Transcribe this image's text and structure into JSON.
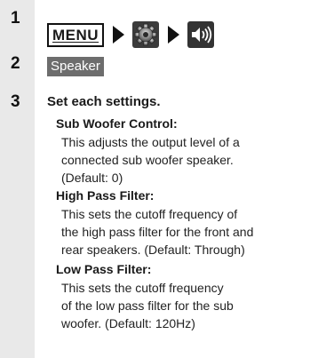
{
  "steps": [
    {
      "number": "1"
    },
    {
      "number": "2"
    },
    {
      "number": "3"
    }
  ],
  "step1": {
    "menu_key": "MENU",
    "icons": [
      "settings-gear-icon",
      "speaker-volume-icon"
    ]
  },
  "step2": {
    "button_label": "Speaker"
  },
  "step3": {
    "title": "Set each settings.",
    "items": [
      {
        "term": "Sub Woofer Control:",
        "description": "This adjusts the output level of a\nconnected sub woofer speaker.\n(Default: 0)"
      },
      {
        "term": "High Pass Filter:",
        "description": "This sets the cutoff frequency of\nthe high pass filter for the front and\nrear speakers. (Default: Through)"
      },
      {
        "term": "Low Pass Filter:",
        "description": "This sets the cutoff frequency\nof the low pass filter for the sub\nwoofer. (Default: 120Hz)"
      }
    ]
  },
  "colors": {
    "sidebar": "#e9e9e9",
    "button": "#6d6d6d"
  }
}
